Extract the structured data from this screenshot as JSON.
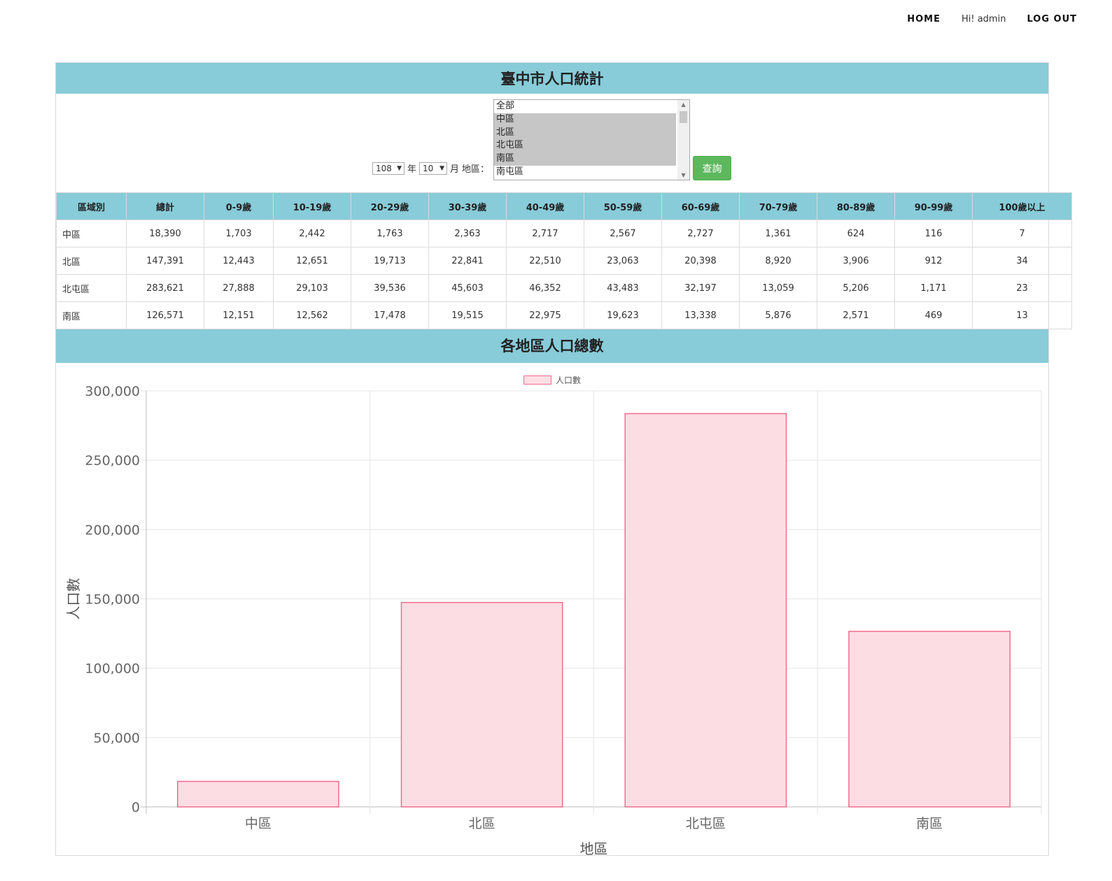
{
  "nav": {
    "home": "HOME",
    "greeting": "Hi! admin",
    "logout": "LOG OUT"
  },
  "page": {
    "title": "臺中市人口統計",
    "chart_title": "各地區人口總數"
  },
  "form": {
    "year_value": "108",
    "year_suffix": "年",
    "month_value": "10",
    "month_suffix": "月",
    "area_label": "地區：",
    "area_options": [
      {
        "label": "全部",
        "selected": false
      },
      {
        "label": "中區",
        "selected": true
      },
      {
        "label": "北區",
        "selected": true
      },
      {
        "label": "北屯區",
        "selected": true
      },
      {
        "label": "南區",
        "selected": true
      },
      {
        "label": "南屯區",
        "selected": false
      }
    ],
    "submit_label": "查詢"
  },
  "table": {
    "headers": [
      "區域別",
      "總計",
      "0-9歲",
      "10-19歲",
      "20-29歲",
      "30-39歲",
      "40-49歲",
      "50-59歲",
      "60-69歲",
      "70-79歲",
      "80-89歲",
      "90-99歲",
      "100歲以上"
    ],
    "rows": [
      [
        "中區",
        "18,390",
        "1,703",
        "2,442",
        "1,763",
        "2,363",
        "2,717",
        "2,567",
        "2,727",
        "1,361",
        "624",
        "116",
        "7"
      ],
      [
        "北區",
        "147,391",
        "12,443",
        "12,651",
        "19,713",
        "22,841",
        "22,510",
        "23,063",
        "20,398",
        "8,920",
        "3,906",
        "912",
        "34"
      ],
      [
        "北屯區",
        "283,621",
        "27,888",
        "29,103",
        "39,536",
        "45,603",
        "46,352",
        "43,483",
        "32,197",
        "13,059",
        "5,206",
        "1,171",
        "23"
      ],
      [
        "南區",
        "126,571",
        "12,151",
        "12,562",
        "17,478",
        "19,515",
        "22,975",
        "19,623",
        "13,338",
        "5,876",
        "2,571",
        "469",
        "13"
      ]
    ]
  },
  "colors": {
    "banner": "#88ccd9",
    "button": "#5cb85c",
    "bar_fill": "#fddde4",
    "bar_border": "#f06d8f"
  },
  "chart_data": {
    "type": "bar",
    "categories": [
      "中區",
      "北區",
      "北屯區",
      "南區"
    ],
    "series": [
      {
        "name": "人口數",
        "values": [
          18390,
          147391,
          283621,
          126571
        ]
      }
    ],
    "xlabel": "地區",
    "ylabel": "人口數",
    "ylim": [
      0,
      300000
    ],
    "yticks": [
      "0",
      "50,000",
      "100,000",
      "150,000",
      "200,000",
      "250,000",
      "300,000"
    ],
    "grid": true,
    "legend": "top-center"
  }
}
